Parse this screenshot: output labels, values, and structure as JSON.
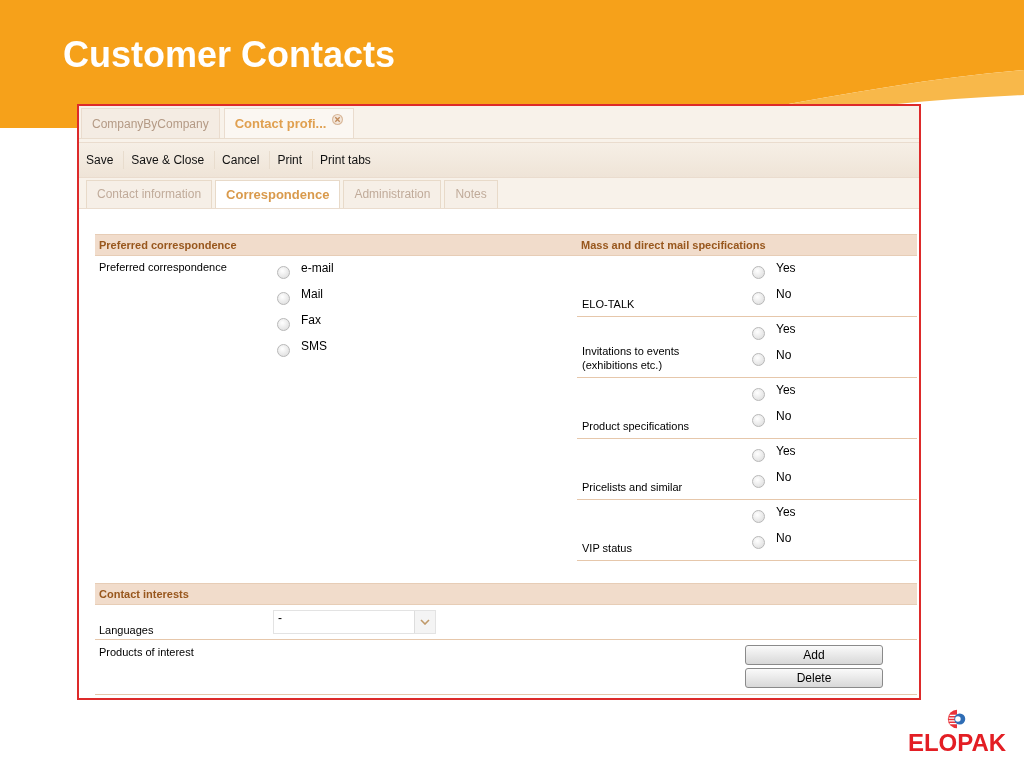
{
  "slide": {
    "title": "Customer Contacts",
    "logo_text": "ELOPAK"
  },
  "doc_tabs": [
    {
      "label": "CompanyByCompany",
      "selected": false,
      "closable": false
    },
    {
      "label": "Contact profi...",
      "selected": true,
      "closable": true
    }
  ],
  "toolbar": [
    "Save",
    "Save & Close",
    "Cancel",
    "Print",
    "Print tabs"
  ],
  "form_tabs": [
    {
      "label": "Contact information",
      "selected": false
    },
    {
      "label": "Correspondence",
      "selected": true
    },
    {
      "label": "Administration",
      "selected": false
    },
    {
      "label": "Notes",
      "selected": false
    }
  ],
  "preferred": {
    "heading": "Preferred correspondence",
    "label": "Preferred correspondence",
    "options": [
      {
        "label": "e-mail",
        "selected": false
      },
      {
        "label": "Mail",
        "selected": false
      },
      {
        "label": "Fax",
        "selected": false
      },
      {
        "label": "SMS",
        "selected": false
      }
    ]
  },
  "mass_mail": {
    "heading": "Mass and direct mail specifications",
    "rows": [
      {
        "label": "ELO-TALK",
        "options": [
          {
            "label": "Yes",
            "selected": false
          },
          {
            "label": "No",
            "selected": false
          }
        ]
      },
      {
        "label": "Invitations to events (exhibitions etc.)",
        "options": [
          {
            "label": "Yes",
            "selected": false
          },
          {
            "label": "No",
            "selected": false
          }
        ]
      },
      {
        "label": "Product specifications",
        "options": [
          {
            "label": "Yes",
            "selected": false
          },
          {
            "label": "No",
            "selected": false
          }
        ]
      },
      {
        "label": "Pricelists and similar",
        "options": [
          {
            "label": "Yes",
            "selected": false
          },
          {
            "label": "No",
            "selected": false
          }
        ]
      },
      {
        "label": "VIP status",
        "options": [
          {
            "label": "Yes",
            "selected": false
          },
          {
            "label": "No",
            "selected": false
          }
        ]
      }
    ]
  },
  "interests": {
    "heading": "Contact interests",
    "languages": {
      "label": "Languages",
      "value": "-"
    },
    "products": {
      "label": "Products of interest",
      "buttons": [
        "Add",
        "Delete"
      ]
    }
  }
}
